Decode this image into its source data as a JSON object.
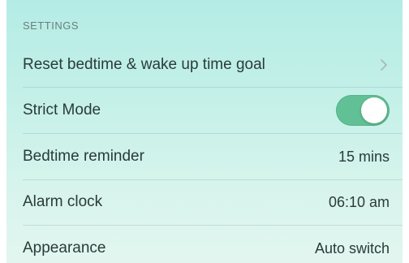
{
  "settings": {
    "header": "SETTINGS",
    "rows": [
      {
        "label": "Reset bedtime & wake up time goal",
        "kind": "chevron",
        "icon": "chevron-right-icon"
      },
      {
        "label": "Strict Mode",
        "kind": "toggle",
        "toggle_on": true,
        "toggle_color": "#61c095"
      },
      {
        "label": "Bedtime reminder",
        "value": "15 mins"
      },
      {
        "label": "Alarm clock",
        "value": "06:10 am"
      },
      {
        "label": "Appearance",
        "value": "Auto switch"
      }
    ]
  },
  "colors": {
    "background_top": "#b4ece5",
    "background_bottom": "#e2f6ef",
    "text": "#2a3b3a",
    "header_text": "#6b7f7b",
    "accent_toggle": "#61c095"
  }
}
